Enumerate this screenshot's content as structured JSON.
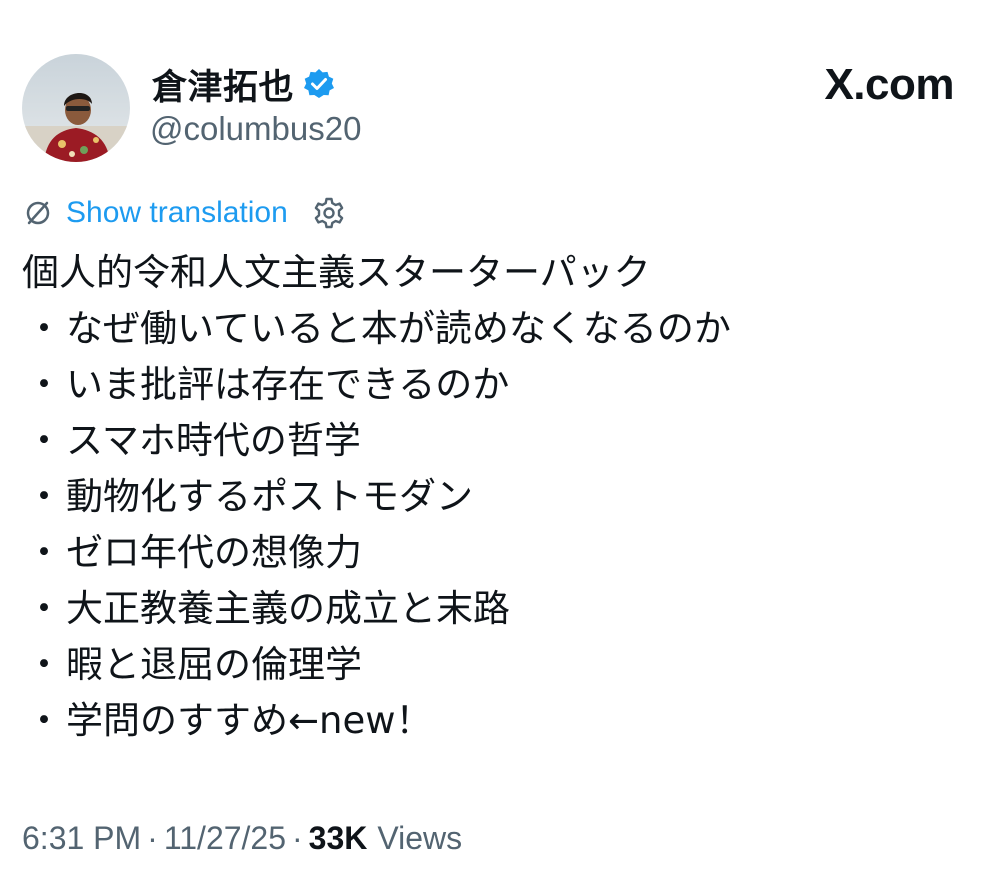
{
  "author": {
    "display_name": "倉津拓也",
    "handle": "@columbus20",
    "verified": true
  },
  "brand": "X.com",
  "translation": {
    "link_label": "Show translation"
  },
  "tweet": {
    "title_line": "個人的令和人文主義スターターパック",
    "bullet_char": "・",
    "items": [
      "なぜ働いていると本が読めなくなるのか",
      "いま批評は存在できるのか",
      "スマホ時代の哲学",
      "動物化するポストモダン",
      "ゼロ年代の想像力",
      "大正教養主義の成立と末路",
      "暇と退屈の倫理学",
      "学問のすすめ←new！"
    ]
  },
  "meta": {
    "time": "6:31 PM",
    "separator": "·",
    "date": "11/27/25",
    "views_count": "33K",
    "views_label": "Views"
  },
  "colors": {
    "link": "#1d9bf0",
    "secondary_text": "#536471",
    "primary_text": "#0f1419",
    "verified_badge": "#1d9bf0"
  }
}
